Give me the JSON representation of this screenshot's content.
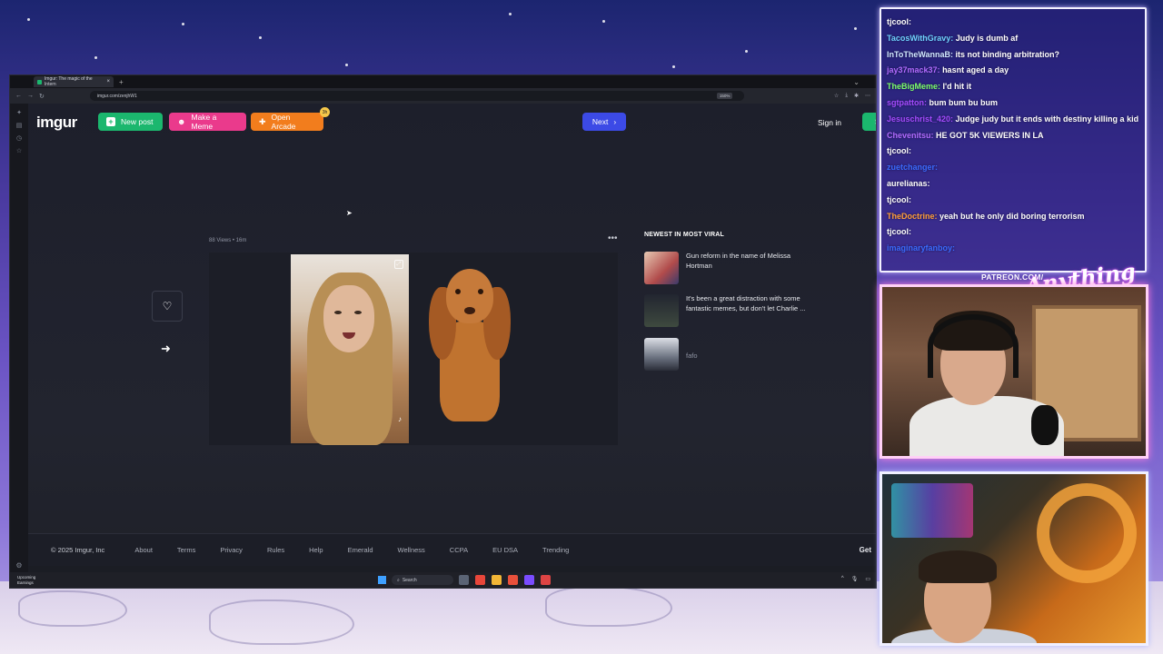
{
  "browser": {
    "tab_title": "Imgur: The magic of the Intern",
    "url": "imgur.com/zenjhW1",
    "zoom": "150%"
  },
  "header": {
    "logo": "imgur",
    "new_post": "New post",
    "make_meme": "Make a Meme",
    "open_arcade": "Open Arcade",
    "arcade_badge": "3h",
    "next": "Next",
    "sign_in": "Sign in",
    "sign_up": "S"
  },
  "post": {
    "meta": "88 Views • 16m"
  },
  "sidebar": {
    "title": "NEWEST IN MOST VIRAL",
    "items": [
      {
        "text": "Gun reform in the name of Melissa Hortman"
      },
      {
        "text": "It's been a great distraction with some fantastic memes, but don't let Charlie ..."
      },
      {
        "text": "fafo"
      }
    ]
  },
  "footer": {
    "copyright": "© 2025 Imgur, Inc",
    "links": [
      "About",
      "Terms",
      "Privacy",
      "Rules",
      "Help",
      "Emerald",
      "Wellness",
      "CCPA",
      "EU DSA",
      "Trending"
    ],
    "get": "Get"
  },
  "taskbar": {
    "weather_line1": "Upcoming",
    "weather_line2": "Earnings",
    "search": "Search"
  },
  "chat": {
    "lines": [
      {
        "user": "tjcool:",
        "msg": "",
        "color": "#ffffff"
      },
      {
        "user": "TacosWithGravy:",
        "msg": "Judy is dumb af",
        "color": "#6fd3ff"
      },
      {
        "user": "InToTheWannaB:",
        "msg": "its not binding arbitration?",
        "color": "#d0e8ff"
      },
      {
        "user": "jay37mack37:",
        "msg": "hasnt aged a day",
        "color": "#b06bff"
      },
      {
        "user": "TheBigMeme:",
        "msg": "I'd hit it",
        "color": "#7cff6b"
      },
      {
        "user": "sgtpatton:",
        "msg": "bum bum bu bum",
        "color": "#a44bff"
      },
      {
        "user": "Jesuschrist_420:",
        "msg": "Judge judy but it ends with destiny killing a kid",
        "color": "#a44bff"
      },
      {
        "user": "Chevenitsu:",
        "msg": "HE GOT 5K VIEWERS IN LA",
        "color": "#b06bff"
      },
      {
        "user": "tjcool:",
        "msg": "",
        "color": "#ffffff"
      },
      {
        "user": "zuetchanger:",
        "msg": "",
        "color": "#3b6bff"
      },
      {
        "user": "aurelianas:",
        "msg": "",
        "color": "#ffffff"
      },
      {
        "user": "tjcool:",
        "msg": "",
        "color": "#ffffff"
      },
      {
        "user": "TheDoctrine:",
        "msg": "yeah but he only did boring terrorism",
        "color": "#ff9f3b"
      },
      {
        "user": "tjcool:",
        "msg": "",
        "color": "#ffffff"
      },
      {
        "user": "imaginaryfanboy:",
        "msg": "",
        "color": "#3b6bff"
      }
    ]
  },
  "overlay": {
    "patreon": "PATREON.COM/",
    "signature": "Anything Else"
  },
  "colors": {
    "imgur_green": "#1bb76e",
    "meme_pink": "#ea3a8c",
    "arcade_orange": "#f27d1d",
    "next_blue": "#3c4ae6"
  }
}
